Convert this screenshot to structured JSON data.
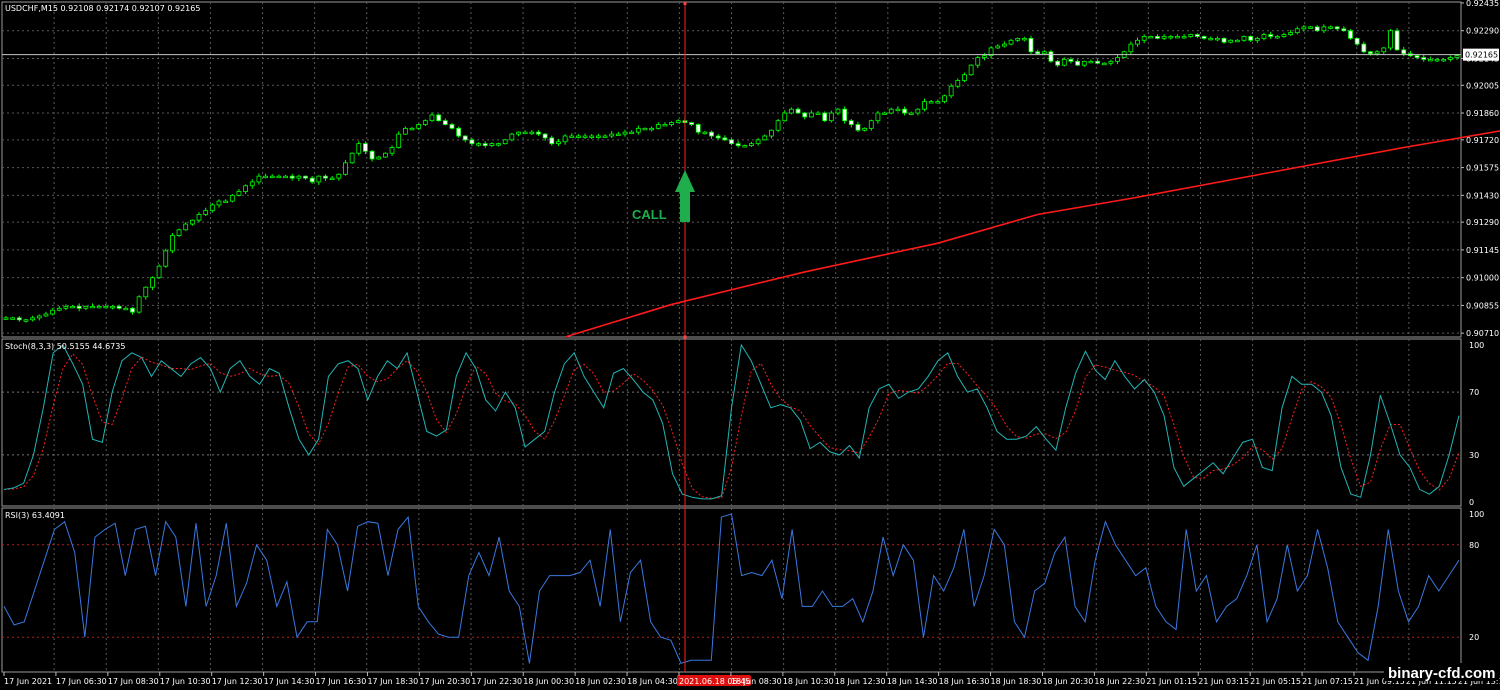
{
  "chart_data": [
    {
      "type": "candlestick",
      "title": "USDCHF,M15  0.92108 0.92174 0.92107 0.92165",
      "ylim": [
        0.9069,
        0.9244
      ],
      "y_ticks": [
        "0.92435",
        "0.92290",
        "0.92145",
        "0.92005",
        "0.91860",
        "0.91720",
        "0.91575",
        "0.91430",
        "0.91290",
        "0.91145",
        "0.91000",
        "0.90855",
        "0.90710"
      ],
      "current_price_label": "0.92165",
      "annotation": "CALL",
      "colors": {
        "bull": "#00ff00",
        "bear": "#ffffff",
        "ma": "#ff1a1a",
        "signal": "#1fae4b"
      },
      "close_series": [
        0.9079,
        0.9079,
        0.9078,
        0.9078,
        0.9079,
        0.908,
        0.9081,
        0.9083,
        0.9084,
        0.9085,
        0.9085,
        0.9084,
        0.9085,
        0.9085,
        0.9085,
        0.9085,
        0.9085,
        0.9084,
        0.9084,
        0.9082,
        0.909,
        0.9095,
        0.91,
        0.9106,
        0.9114,
        0.9122,
        0.9125,
        0.9128,
        0.913,
        0.9133,
        0.9135,
        0.9138,
        0.914,
        0.914,
        0.9143,
        0.9145,
        0.9148,
        0.915,
        0.9153,
        0.9153,
        0.9153,
        0.9153,
        0.9153,
        0.9152,
        0.9153,
        0.9152,
        0.915,
        0.9153,
        0.9152,
        0.9152,
        0.9154,
        0.916,
        0.9165,
        0.917,
        0.9166,
        0.9162,
        0.9163,
        0.9165,
        0.9168,
        0.9175,
        0.9178,
        0.9178,
        0.918,
        0.9182,
        0.9185,
        0.9182,
        0.918,
        0.9178,
        0.9174,
        0.9172,
        0.917,
        0.917,
        0.9169,
        0.917,
        0.917,
        0.9172,
        0.9175,
        0.9176,
        0.9176,
        0.9176,
        0.9175,
        0.9173,
        0.917,
        0.9171,
        0.9174,
        0.9174,
        0.9174,
        0.9174,
        0.9174,
        0.9174,
        0.9174,
        0.9175,
        0.9175,
        0.9176,
        0.9176,
        0.9178,
        0.9178,
        0.9178,
        0.918,
        0.918,
        0.9181,
        0.9182,
        0.9181,
        0.918,
        0.9176,
        0.9176,
        0.9174,
        0.9173,
        0.9172,
        0.917,
        0.9169,
        0.9169,
        0.917,
        0.9172,
        0.9174,
        0.9177,
        0.9182,
        0.9186,
        0.9188,
        0.9186,
        0.9184,
        0.9186,
        0.9186,
        0.9182,
        0.9186,
        0.9188,
        0.9182,
        0.918,
        0.9177,
        0.9178,
        0.9182,
        0.9186,
        0.9186,
        0.9188,
        0.9188,
        0.9186,
        0.9186,
        0.9188,
        0.9192,
        0.9192,
        0.9192,
        0.9195,
        0.92,
        0.9203,
        0.9206,
        0.9211,
        0.9215,
        0.9216,
        0.922,
        0.9221,
        0.9222,
        0.9224,
        0.9225,
        0.9225,
        0.9218,
        0.9217,
        0.9218,
        0.9213,
        0.9211,
        0.9214,
        0.9213,
        0.9211,
        0.9213,
        0.9213,
        0.9212,
        0.9212,
        0.9213,
        0.9215,
        0.9218,
        0.9222,
        0.9224,
        0.9226,
        0.9226,
        0.9225,
        0.9226,
        0.9226,
        0.9226,
        0.9226,
        0.9227,
        0.9226,
        0.9225,
        0.9225,
        0.9225,
        0.9223,
        0.9224,
        0.9224,
        0.9226,
        0.9224,
        0.9225,
        0.9227,
        0.9226,
        0.9226,
        0.9227,
        0.9228,
        0.923,
        0.9231,
        0.9231,
        0.9229,
        0.9231,
        0.9231,
        0.923,
        0.9229,
        0.9225,
        0.9222,
        0.9218,
        0.9217,
        0.9218,
        0.922,
        0.9229,
        0.9219,
        0.9217,
        0.9216,
        0.9215,
        0.9214,
        0.9214,
        0.9214,
        0.9214,
        0.9215,
        0.9216
      ],
      "ma_series": [
        {
          "i": 84,
          "v": 0.9069
        },
        {
          "i": 100,
          "v": 0.9086
        },
        {
          "i": 120,
          "v": 0.9103
        },
        {
          "i": 140,
          "v": 0.9118
        },
        {
          "i": 155,
          "v": 0.9133
        },
        {
          "i": 170,
          "v": 0.9142
        },
        {
          "i": 190,
          "v": 0.9155
        },
        {
          "i": 210,
          "v": 0.9168
        },
        {
          "i": 230,
          "v": 0.918
        },
        {
          "i": 250,
          "v": 0.9189
        },
        {
          "i": 270,
          "v": 0.9196
        },
        {
          "i": 290,
          "v": 0.9201
        }
      ]
    },
    {
      "type": "line",
      "title": "Stoch(8,3,3) 50.5155 44.6735",
      "ylim": [
        0,
        100
      ],
      "y_ticks": [
        "100",
        "70",
        "30",
        "0"
      ],
      "levels": [
        70,
        30
      ],
      "colors": {
        "main": "#22b5b5",
        "signal": "#ff2020"
      },
      "main_series": [
        8,
        9,
        12,
        30,
        60,
        95,
        100,
        88,
        75,
        40,
        38,
        70,
        90,
        95,
        92,
        80,
        90,
        85,
        80,
        88,
        92,
        85,
        70,
        85,
        90,
        80,
        75,
        85,
        82,
        60,
        40,
        30,
        40,
        80,
        88,
        90,
        85,
        65,
        80,
        90,
        85,
        95,
        70,
        45,
        42,
        46,
        80,
        95,
        85,
        65,
        58,
        70,
        60,
        35,
        40,
        45,
        70,
        88,
        95,
        80,
        70,
        60,
        82,
        85,
        78,
        70,
        65,
        50,
        18,
        5,
        3,
        2,
        2,
        4,
        60,
        100,
        90,
        75,
        60,
        62,
        60,
        52,
        34,
        38,
        32,
        30,
        36,
        28,
        60,
        72,
        75,
        66,
        70,
        72,
        80,
        90,
        95,
        80,
        70,
        72,
        60,
        45,
        40,
        40,
        42,
        48,
        40,
        33,
        60,
        82,
        96,
        84,
        78,
        90,
        80,
        72,
        78,
        70,
        55,
        22,
        10,
        15,
        20,
        25,
        18,
        28,
        38,
        40,
        22,
        20,
        60,
        80,
        75,
        75,
        70,
        55,
        22,
        5,
        3,
        30,
        68,
        50,
        30,
        22,
        8,
        5,
        10,
        30,
        55
      ]
    },
    {
      "type": "line",
      "title": "RSI(3) 63.4091",
      "ylim": [
        0,
        100
      ],
      "y_ticks": [
        "100",
        "80",
        "20"
      ],
      "levels": [
        80,
        20
      ],
      "colors": {
        "main": "#3a78e0",
        "level": "#b02020"
      },
      "main_series": [
        40,
        28,
        30,
        50,
        70,
        90,
        95,
        75,
        20,
        85,
        90,
        94,
        60,
        90,
        92,
        60,
        95,
        85,
        40,
        94,
        40,
        60,
        94,
        40,
        55,
        80,
        70,
        40,
        56,
        20,
        30,
        30,
        90,
        80,
        50,
        92,
        95,
        94,
        60,
        90,
        98,
        40,
        30,
        22,
        20,
        20,
        60,
        75,
        60,
        85,
        50,
        40,
        3,
        50,
        60,
        60,
        60,
        62,
        70,
        40,
        90,
        30,
        62,
        70,
        30,
        20,
        18,
        3,
        5,
        5,
        5,
        98,
        100,
        60,
        62,
        60,
        70,
        45,
        90,
        40,
        40,
        50,
        40,
        40,
        45,
        30,
        50,
        85,
        60,
        80,
        70,
        20,
        60,
        50,
        65,
        90,
        40,
        60,
        90,
        80,
        30,
        20,
        50,
        55,
        75,
        85,
        40,
        30,
        70,
        95,
        80,
        70,
        60,
        65,
        40,
        30,
        25,
        90,
        50,
        60,
        30,
        40,
        45,
        60,
        80,
        30,
        45,
        80,
        50,
        60,
        90,
        65,
        30,
        20,
        10,
        5,
        40,
        90,
        50,
        30,
        40,
        60,
        50,
        60,
        70
      ]
    }
  ],
  "x_axis": {
    "labels": [
      "17 Jun 2021",
      "17 Jun 06:30",
      "17 Jun 08:30",
      "17 Jun 10:30",
      "17 Jun 12:30",
      "17 Jun 14:30",
      "17 Jun 16:30",
      "17 Jun 18:30",
      "17 Jun 20:30",
      "17 Jun 22:30",
      "18 Jun 00:30",
      "18 Jun 02:30",
      "18 Jun 04:30",
      "2021.06.18 06:45",
      "18 Jun 08:30",
      "18 Jun 10:30",
      "18 Jun 12:30",
      "18 Jun 14:30",
      "18 Jun 16:30",
      "18 Jun 18:30",
      "18 Jun 20:30",
      "18 Jun 22:30",
      "21 Jun 01:15",
      "21 Jun 03:15",
      "21 Jun 05:15",
      "21 Jun 07:15",
      "21 Jun 09:15",
      "21 Jun 11:15",
      "21 Jun 13:1"
    ],
    "highlight_index": 13
  },
  "watermark": "binary-cfd.com"
}
